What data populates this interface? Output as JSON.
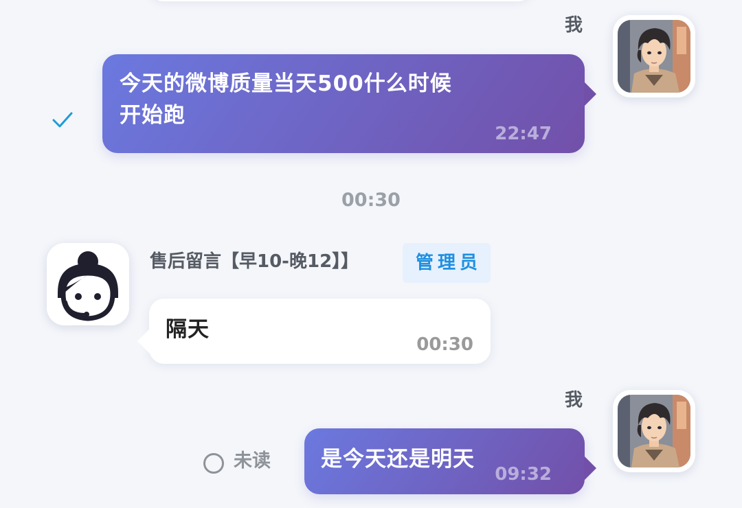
{
  "accent_colors": {
    "outgoing_bubble_start": "#6b79df",
    "outgoing_bubble_end": "#7250a9",
    "incoming_bubble": "#ffffff",
    "read_check": "#1e9bd7",
    "admin_badge_bg": "#e6f1fd",
    "admin_badge_text": "#1f8fe0"
  },
  "messages": [
    {
      "direction": "outgoing",
      "sender_name": "我",
      "text_lines": [
        "今天的微博质量当天500什么时候",
        "开始跑"
      ],
      "time": "22:47",
      "status_icon": "read-check-icon"
    },
    {
      "direction": "divider",
      "time": "00:30"
    },
    {
      "direction": "incoming",
      "sender_name": "售后留言【早10-晚12】】",
      "role_badge": "管理员",
      "avatar_icon": "customer-service-agent-icon",
      "text": "隔天",
      "time": "00:30"
    },
    {
      "direction": "outgoing",
      "sender_name": "我",
      "text": "是今天还是明天",
      "time": "09:32",
      "status_label": "未读",
      "status_icon": "unread-circle-icon"
    }
  ]
}
